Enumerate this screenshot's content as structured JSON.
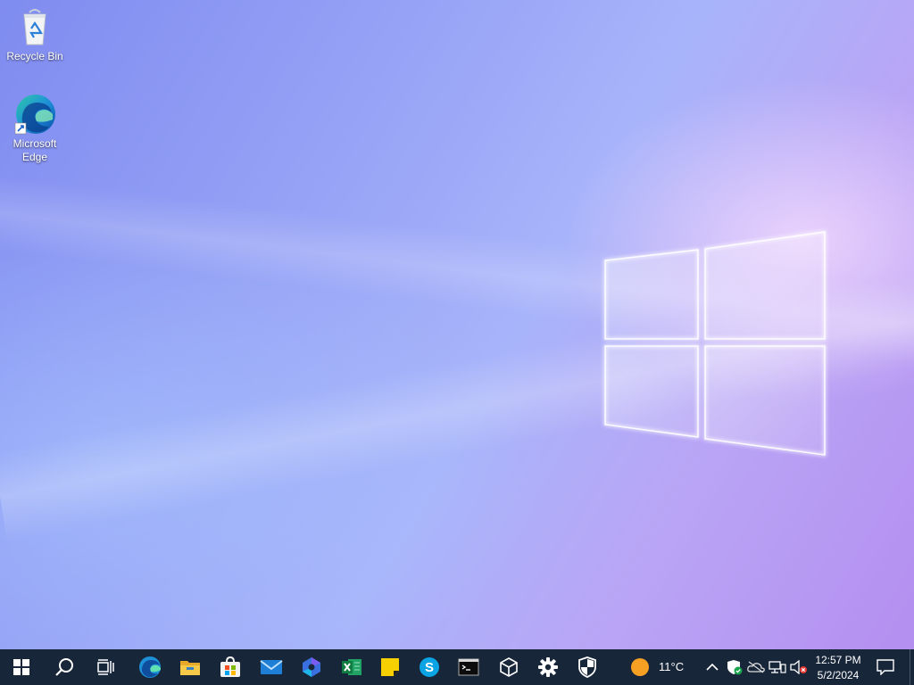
{
  "desktop": {
    "icons": [
      {
        "label": "Recycle Bin"
      },
      {
        "label": "Microsoft Edge"
      }
    ]
  },
  "taskbar": {
    "apps": [
      "start-icon",
      "search-icon",
      "task-view-icon",
      "edge-icon",
      "file-explorer-icon",
      "store-icon",
      "mail-icon",
      "copilot-icon",
      "excel-icon",
      "sticky-notes-icon",
      "skype-icon",
      "terminal-icon",
      "3d-viewer-icon",
      "settings-icon",
      "windows-security-icon"
    ],
    "weather": {
      "temperature": "11°C",
      "icon": "sun-icon"
    },
    "tray_icons": [
      "chevron-up-icon",
      "defender-icon",
      "onedrive-icon",
      "network-icon",
      "volume-muted-icon"
    ],
    "clock": {
      "time": "12:57 PM",
      "date": "5/2/2024"
    },
    "notification_icon": "action-center-icon"
  },
  "colors": {
    "taskbar": "#18263a",
    "wallpaper_accent": "#9aa5f5"
  }
}
